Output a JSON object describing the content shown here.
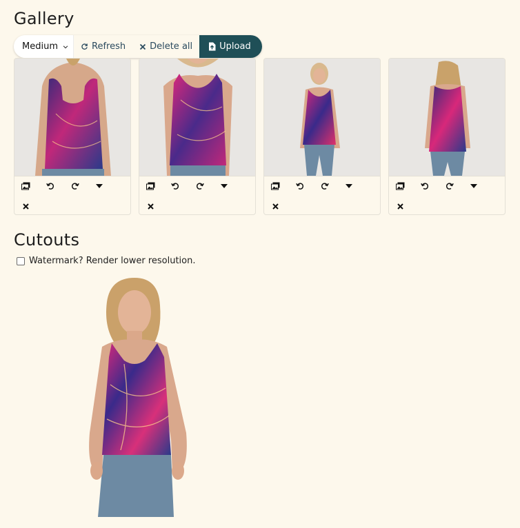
{
  "gallery": {
    "title": "Gallery",
    "toolbar": {
      "size_select_value": "Medium",
      "refresh_label": "Refresh",
      "delete_all_label": "Delete all",
      "upload_label": "Upload"
    },
    "items": [
      {
        "view": "back",
        "icons": [
          "image-stack-icon",
          "rotate-left-icon",
          "rotate-right-icon",
          "caret-down-icon",
          "close-icon"
        ]
      },
      {
        "view": "front",
        "icons": [
          "image-stack-icon",
          "rotate-left-icon",
          "rotate-right-icon",
          "caret-down-icon",
          "close-icon"
        ]
      },
      {
        "view": "front-full",
        "icons": [
          "image-stack-icon",
          "rotate-left-icon",
          "rotate-right-icon",
          "caret-down-icon",
          "close-icon"
        ]
      },
      {
        "view": "back-full",
        "icons": [
          "image-stack-icon",
          "rotate-left-icon",
          "rotate-right-icon",
          "caret-down-icon",
          "close-icon"
        ]
      }
    ]
  },
  "cutouts": {
    "title": "Cutouts",
    "watermark_label": "Watermark? Render lower resolution.",
    "watermark_checked": false
  },
  "colors": {
    "background": "#fdf8ec",
    "primary": "#1f4f57",
    "link": "#2a4a5e"
  }
}
